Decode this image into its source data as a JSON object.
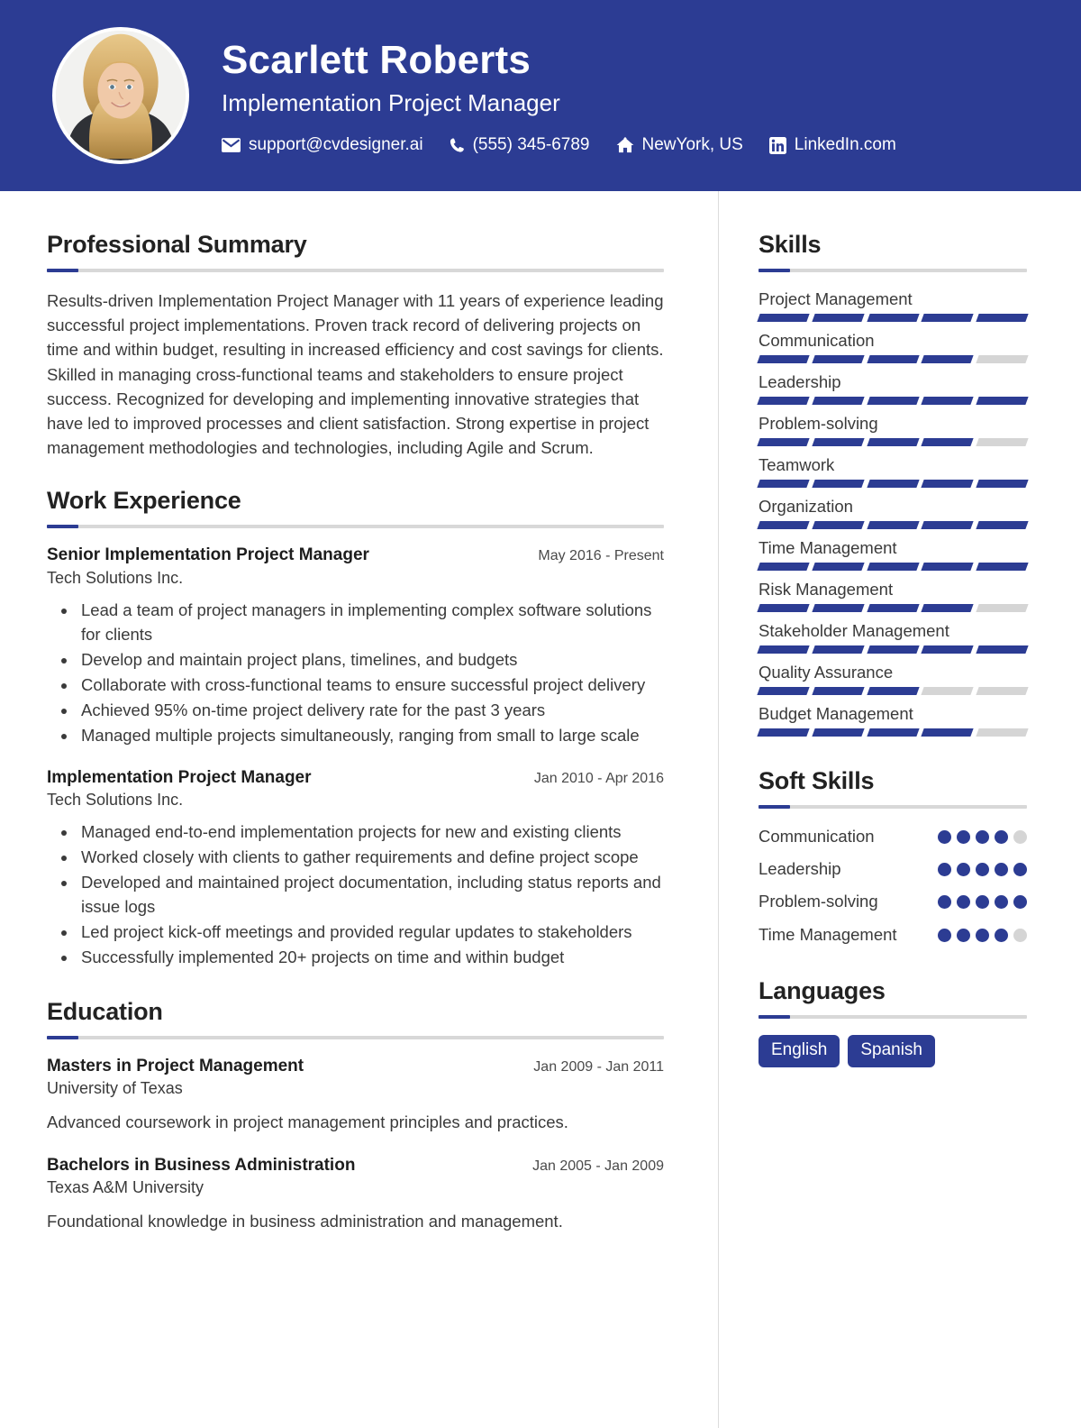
{
  "header": {
    "name": "Scarlett Roberts",
    "job_title": "Implementation Project Manager",
    "accent_color": "#2C3C93",
    "contacts": [
      {
        "icon": "envelope-icon",
        "text": "support@cvdesigner.ai"
      },
      {
        "icon": "phone-icon",
        "text": "(555) 345-6789"
      },
      {
        "icon": "home-icon",
        "text": "NewYork, US"
      },
      {
        "icon": "linkedin-icon",
        "text": "LinkedIn.com"
      }
    ]
  },
  "summary": {
    "title": "Professional Summary",
    "text": "Results-driven Implementation Project Manager with 11 years of experience leading successful project implementations. Proven track record of delivering projects on time and within budget, resulting in increased efficiency and cost savings for clients. Skilled in managing cross-functional teams and stakeholders to ensure project success. Recognized for developing and implementing innovative strategies that have led to improved processes and client satisfaction. Strong expertise in project management methodologies and technologies, including Agile and Scrum."
  },
  "experience": {
    "title": "Work Experience",
    "entries": [
      {
        "position": "Senior Implementation Project Manager",
        "date": "May 2016 - Present",
        "company": "Tech Solutions Inc.",
        "bullets": [
          "Lead a team of project managers in implementing complex software solutions for clients",
          "Develop and maintain project plans, timelines, and budgets",
          "Collaborate with cross-functional teams to ensure successful project delivery",
          "Achieved 95% on-time project delivery rate for the past 3 years",
          "Managed multiple projects simultaneously, ranging from small to large scale"
        ]
      },
      {
        "position": "Implementation Project Manager",
        "date": "Jan 2010 - Apr 2016",
        "company": "Tech Solutions Inc.",
        "bullets": [
          "Managed end-to-end implementation projects for new and existing clients",
          "Worked closely with clients to gather requirements and define project scope",
          "Developed and maintained project documentation, including status reports and issue logs",
          "Led project kick-off meetings and provided regular updates to stakeholders",
          "Successfully implemented 20+ projects on time and within budget"
        ]
      }
    ]
  },
  "education": {
    "title": "Education",
    "entries": [
      {
        "degree": "Masters in Project Management",
        "date": "Jan 2009 - Jan 2011",
        "school": "University of Texas",
        "description": "Advanced coursework in project management principles and practices."
      },
      {
        "degree": "Bachelors in Business Administration",
        "date": "Jan 2005 - Jan 2009",
        "school": "Texas A&M University",
        "description": "Foundational knowledge in business administration and management."
      }
    ]
  },
  "skills": {
    "title": "Skills",
    "max_level": 5,
    "items": [
      {
        "name": "Project Management",
        "level": 5
      },
      {
        "name": "Communication",
        "level": 4
      },
      {
        "name": "Leadership",
        "level": 5
      },
      {
        "name": "Problem-solving",
        "level": 4
      },
      {
        "name": "Teamwork",
        "level": 5
      },
      {
        "name": "Organization",
        "level": 5
      },
      {
        "name": "Time Management",
        "level": 5
      },
      {
        "name": "Risk Management",
        "level": 4
      },
      {
        "name": "Stakeholder Management",
        "level": 5
      },
      {
        "name": "Quality Assurance",
        "level": 3
      },
      {
        "name": "Budget Management",
        "level": 4
      }
    ]
  },
  "soft_skills": {
    "title": "Soft Skills",
    "max_level": 5,
    "items": [
      {
        "name": "Communication",
        "level": 4
      },
      {
        "name": "Leadership",
        "level": 5
      },
      {
        "name": "Problem-solving",
        "level": 5
      },
      {
        "name": "Time Management",
        "level": 4
      }
    ]
  },
  "languages": {
    "title": "Languages",
    "items": [
      "English",
      "Spanish"
    ]
  }
}
